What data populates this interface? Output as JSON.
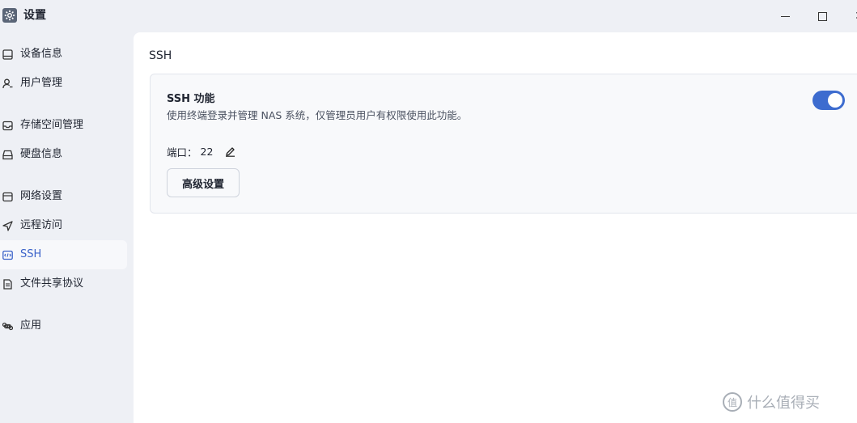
{
  "window": {
    "title": "设置",
    "app_icon": "gear-icon",
    "controls": {
      "minimize": "minimize-icon",
      "maximize": "maximize-icon",
      "close": "close-icon"
    }
  },
  "sidebar": {
    "items": [
      {
        "label": "设备信息",
        "icon": "device-info-icon",
        "active": false
      },
      {
        "label": "用户管理",
        "icon": "user-icon",
        "active": false
      },
      {
        "label": "存储空间管理",
        "icon": "storage-icon",
        "active": false
      },
      {
        "label": "硬盘信息",
        "icon": "hard-disk-icon",
        "active": false
      },
      {
        "label": "网络设置",
        "icon": "network-icon",
        "active": false
      },
      {
        "label": "远程访问",
        "icon": "send-icon",
        "active": false
      },
      {
        "label": "SSH",
        "icon": "code-icon",
        "active": true
      },
      {
        "label": "文件共享协议",
        "icon": "document-icon",
        "active": false
      },
      {
        "label": "应用",
        "icon": "command-icon",
        "active": false
      }
    ]
  },
  "main": {
    "section_title": "SSH",
    "ssh_card": {
      "title": "SSH 功能",
      "description": "使用终端登录并管理 NAS 系统，仅管理员用户有权限使用此功能。",
      "enabled": true,
      "port_label": "端口：",
      "port_value": "22",
      "advanced_button": "高级设置"
    }
  },
  "watermark": {
    "text": "什么值得买",
    "logo_glyph": "值"
  },
  "colors": {
    "accent": "#3d6ccf",
    "active_text": "#3a62c9",
    "sidebar_bg": "#eef0f5",
    "card_bg": "#f8f9fb"
  }
}
